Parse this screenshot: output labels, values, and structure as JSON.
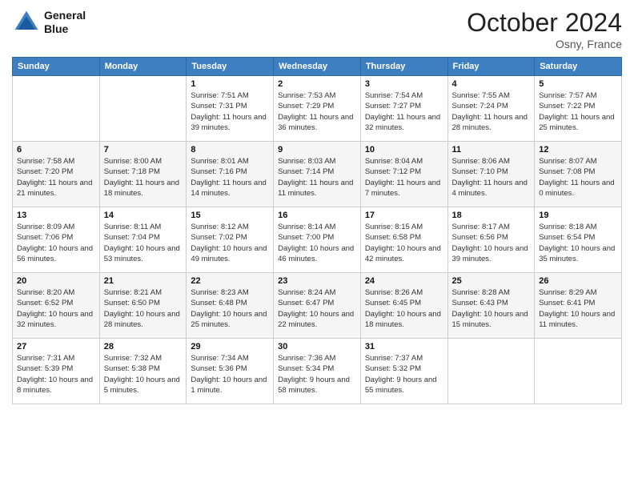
{
  "header": {
    "logo_line1": "General",
    "logo_line2": "Blue",
    "month": "October 2024",
    "location": "Osny, France"
  },
  "weekdays": [
    "Sunday",
    "Monday",
    "Tuesday",
    "Wednesday",
    "Thursday",
    "Friday",
    "Saturday"
  ],
  "weeks": [
    [
      {
        "day": "",
        "sunrise": "",
        "sunset": "",
        "daylight": ""
      },
      {
        "day": "",
        "sunrise": "",
        "sunset": "",
        "daylight": ""
      },
      {
        "day": "1",
        "sunrise": "Sunrise: 7:51 AM",
        "sunset": "Sunset: 7:31 PM",
        "daylight": "Daylight: 11 hours and 39 minutes."
      },
      {
        "day": "2",
        "sunrise": "Sunrise: 7:53 AM",
        "sunset": "Sunset: 7:29 PM",
        "daylight": "Daylight: 11 hours and 36 minutes."
      },
      {
        "day": "3",
        "sunrise": "Sunrise: 7:54 AM",
        "sunset": "Sunset: 7:27 PM",
        "daylight": "Daylight: 11 hours and 32 minutes."
      },
      {
        "day": "4",
        "sunrise": "Sunrise: 7:55 AM",
        "sunset": "Sunset: 7:24 PM",
        "daylight": "Daylight: 11 hours and 28 minutes."
      },
      {
        "day": "5",
        "sunrise": "Sunrise: 7:57 AM",
        "sunset": "Sunset: 7:22 PM",
        "daylight": "Daylight: 11 hours and 25 minutes."
      }
    ],
    [
      {
        "day": "6",
        "sunrise": "Sunrise: 7:58 AM",
        "sunset": "Sunset: 7:20 PM",
        "daylight": "Daylight: 11 hours and 21 minutes."
      },
      {
        "day": "7",
        "sunrise": "Sunrise: 8:00 AM",
        "sunset": "Sunset: 7:18 PM",
        "daylight": "Daylight: 11 hours and 18 minutes."
      },
      {
        "day": "8",
        "sunrise": "Sunrise: 8:01 AM",
        "sunset": "Sunset: 7:16 PM",
        "daylight": "Daylight: 11 hours and 14 minutes."
      },
      {
        "day": "9",
        "sunrise": "Sunrise: 8:03 AM",
        "sunset": "Sunset: 7:14 PM",
        "daylight": "Daylight: 11 hours and 11 minutes."
      },
      {
        "day": "10",
        "sunrise": "Sunrise: 8:04 AM",
        "sunset": "Sunset: 7:12 PM",
        "daylight": "Daylight: 11 hours and 7 minutes."
      },
      {
        "day": "11",
        "sunrise": "Sunrise: 8:06 AM",
        "sunset": "Sunset: 7:10 PM",
        "daylight": "Daylight: 11 hours and 4 minutes."
      },
      {
        "day": "12",
        "sunrise": "Sunrise: 8:07 AM",
        "sunset": "Sunset: 7:08 PM",
        "daylight": "Daylight: 11 hours and 0 minutes."
      }
    ],
    [
      {
        "day": "13",
        "sunrise": "Sunrise: 8:09 AM",
        "sunset": "Sunset: 7:06 PM",
        "daylight": "Daylight: 10 hours and 56 minutes."
      },
      {
        "day": "14",
        "sunrise": "Sunrise: 8:11 AM",
        "sunset": "Sunset: 7:04 PM",
        "daylight": "Daylight: 10 hours and 53 minutes."
      },
      {
        "day": "15",
        "sunrise": "Sunrise: 8:12 AM",
        "sunset": "Sunset: 7:02 PM",
        "daylight": "Daylight: 10 hours and 49 minutes."
      },
      {
        "day": "16",
        "sunrise": "Sunrise: 8:14 AM",
        "sunset": "Sunset: 7:00 PM",
        "daylight": "Daylight: 10 hours and 46 minutes."
      },
      {
        "day": "17",
        "sunrise": "Sunrise: 8:15 AM",
        "sunset": "Sunset: 6:58 PM",
        "daylight": "Daylight: 10 hours and 42 minutes."
      },
      {
        "day": "18",
        "sunrise": "Sunrise: 8:17 AM",
        "sunset": "Sunset: 6:56 PM",
        "daylight": "Daylight: 10 hours and 39 minutes."
      },
      {
        "day": "19",
        "sunrise": "Sunrise: 8:18 AM",
        "sunset": "Sunset: 6:54 PM",
        "daylight": "Daylight: 10 hours and 35 minutes."
      }
    ],
    [
      {
        "day": "20",
        "sunrise": "Sunrise: 8:20 AM",
        "sunset": "Sunset: 6:52 PM",
        "daylight": "Daylight: 10 hours and 32 minutes."
      },
      {
        "day": "21",
        "sunrise": "Sunrise: 8:21 AM",
        "sunset": "Sunset: 6:50 PM",
        "daylight": "Daylight: 10 hours and 28 minutes."
      },
      {
        "day": "22",
        "sunrise": "Sunrise: 8:23 AM",
        "sunset": "Sunset: 6:48 PM",
        "daylight": "Daylight: 10 hours and 25 minutes."
      },
      {
        "day": "23",
        "sunrise": "Sunrise: 8:24 AM",
        "sunset": "Sunset: 6:47 PM",
        "daylight": "Daylight: 10 hours and 22 minutes."
      },
      {
        "day": "24",
        "sunrise": "Sunrise: 8:26 AM",
        "sunset": "Sunset: 6:45 PM",
        "daylight": "Daylight: 10 hours and 18 minutes."
      },
      {
        "day": "25",
        "sunrise": "Sunrise: 8:28 AM",
        "sunset": "Sunset: 6:43 PM",
        "daylight": "Daylight: 10 hours and 15 minutes."
      },
      {
        "day": "26",
        "sunrise": "Sunrise: 8:29 AM",
        "sunset": "Sunset: 6:41 PM",
        "daylight": "Daylight: 10 hours and 11 minutes."
      }
    ],
    [
      {
        "day": "27",
        "sunrise": "Sunrise: 7:31 AM",
        "sunset": "Sunset: 5:39 PM",
        "daylight": "Daylight: 10 hours and 8 minutes."
      },
      {
        "day": "28",
        "sunrise": "Sunrise: 7:32 AM",
        "sunset": "Sunset: 5:38 PM",
        "daylight": "Daylight: 10 hours and 5 minutes."
      },
      {
        "day": "29",
        "sunrise": "Sunrise: 7:34 AM",
        "sunset": "Sunset: 5:36 PM",
        "daylight": "Daylight: 10 hours and 1 minute."
      },
      {
        "day": "30",
        "sunrise": "Sunrise: 7:36 AM",
        "sunset": "Sunset: 5:34 PM",
        "daylight": "Daylight: 9 hours and 58 minutes."
      },
      {
        "day": "31",
        "sunrise": "Sunrise: 7:37 AM",
        "sunset": "Sunset: 5:32 PM",
        "daylight": "Daylight: 9 hours and 55 minutes."
      },
      {
        "day": "",
        "sunrise": "",
        "sunset": "",
        "daylight": ""
      },
      {
        "day": "",
        "sunrise": "",
        "sunset": "",
        "daylight": ""
      }
    ]
  ]
}
